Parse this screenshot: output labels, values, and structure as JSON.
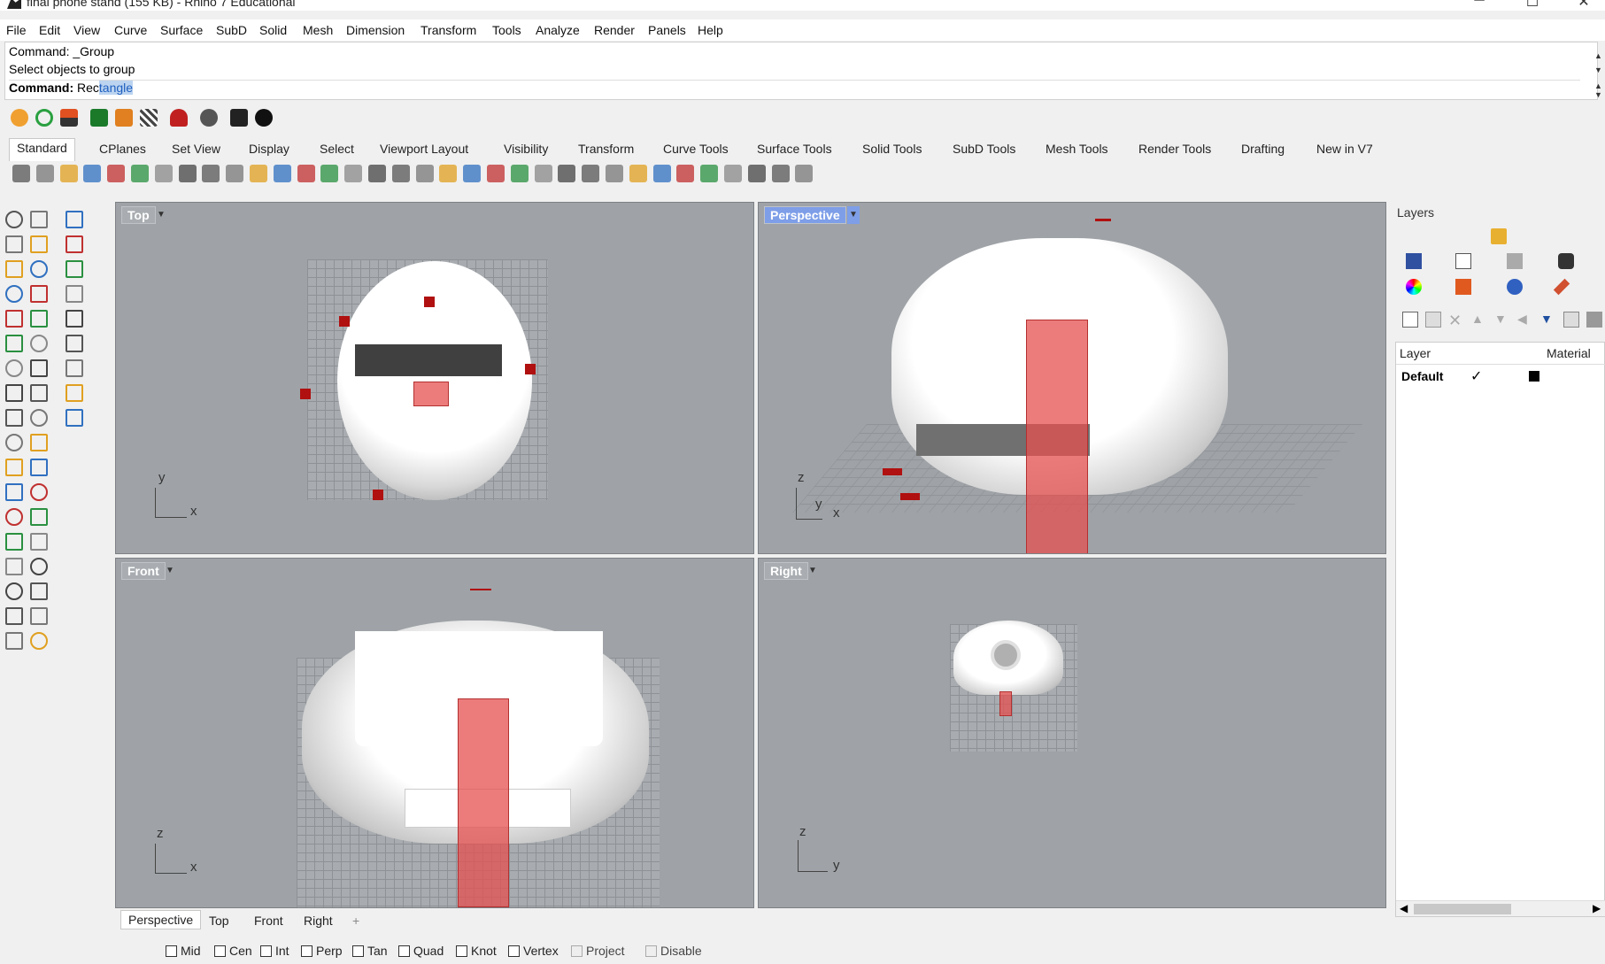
{
  "window": {
    "title": "final phone stand (155 KB) - Rhino 7 Educational",
    "minimize": "─",
    "maximize": "☐",
    "close": "✕"
  },
  "menu": [
    "File",
    "Edit",
    "View",
    "Curve",
    "Surface",
    "SubD",
    "Solid",
    "Mesh",
    "Dimension",
    "Transform",
    "Tools",
    "Analyze",
    "Render",
    "Panels",
    "Help"
  ],
  "command": {
    "history_1": "Command: _Group",
    "history_2": "Select objects to group",
    "prompt_label": "Command:",
    "input_prefix": "Rec",
    "input_selected": "tangle"
  },
  "tabs": [
    "Standard",
    "CPlanes",
    "Set View",
    "Display",
    "Select",
    "Viewport Layout",
    "Visibility",
    "Transform",
    "Curve Tools",
    "Surface Tools",
    "Solid Tools",
    "SubD Tools",
    "Mesh Tools",
    "Render Tools",
    "Drafting",
    "New in V7"
  ],
  "viewports": {
    "top": {
      "label": "Top",
      "axis_y": "y",
      "axis_x": "x"
    },
    "perspective": {
      "label": "Perspective",
      "axis_z": "z",
      "axis_y": "y",
      "axis_x": "x"
    },
    "front": {
      "label": "Front",
      "axis_z": "z",
      "axis_x": "x"
    },
    "right": {
      "label": "Right",
      "axis_z": "z",
      "axis_y": "y"
    }
  },
  "viewport_tabs": [
    "Perspective",
    "Top",
    "Front",
    "Right",
    "+"
  ],
  "osnap": [
    {
      "label": "Mid",
      "disabled": false
    },
    {
      "label": "Cen",
      "disabled": false
    },
    {
      "label": "Int",
      "disabled": false
    },
    {
      "label": "Perp",
      "disabled": false
    },
    {
      "label": "Tan",
      "disabled": false
    },
    {
      "label": "Quad",
      "disabled": false
    },
    {
      "label": "Knot",
      "disabled": false
    },
    {
      "label": "Vertex",
      "disabled": false
    },
    {
      "label": "Project",
      "disabled": true
    },
    {
      "label": "Disable",
      "disabled": true
    }
  ],
  "layers": {
    "title": "Layers",
    "col_layer": "Layer",
    "col_material": "Material",
    "row_name": "Default",
    "row_current": "✓"
  },
  "colors": {
    "viewport_bg": "#9fa3a7",
    "active_label": "#7e9ee8",
    "object_red": "#e05050"
  }
}
